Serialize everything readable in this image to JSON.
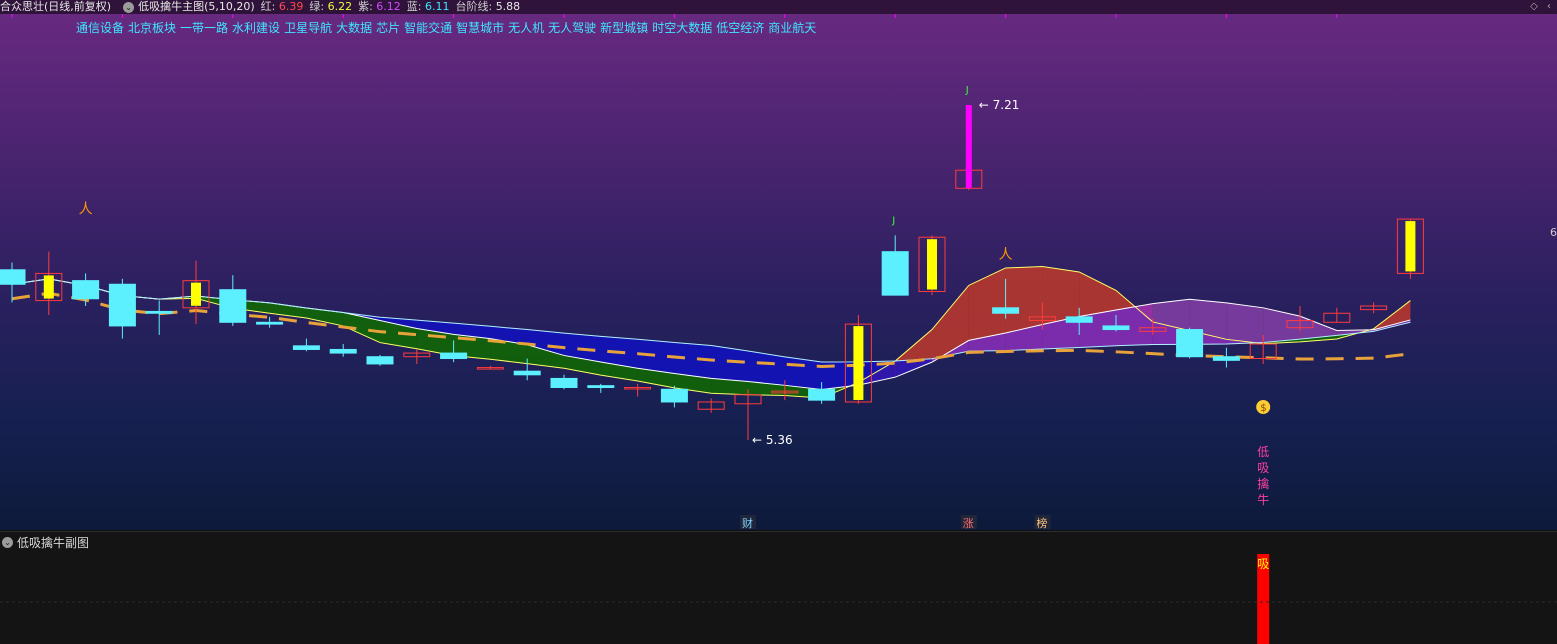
{
  "title_bar": {
    "stock_name": "合众思壮(日线,前复权)",
    "indicator_name": "低吸擒牛主图(5,10,20)",
    "values": [
      {
        "label": "红:",
        "value": "6.39",
        "color": "#ff4b4b"
      },
      {
        "label": "绿:",
        "value": "6.22",
        "color": "#e8ff3a"
      },
      {
        "label": "紫:",
        "value": "6.12",
        "color": "#d24bff"
      },
      {
        "label": "蓝:",
        "value": "6.11",
        "color": "#3ee6ff"
      },
      {
        "label": "台阶线:",
        "value": "5.88",
        "color": "#e8e8e8"
      }
    ]
  },
  "concept_tags": [
    "通信设备",
    "北京板块",
    "一带一路",
    "水利建设",
    "卫星导航",
    "大数据",
    "芯片",
    "智能交通",
    "智慧城市",
    "无人机",
    "无人驾驶",
    "新型城镇",
    "时空大数据",
    "低空经济",
    "商业航天"
  ],
  "annotations": {
    "high_price": "7.21",
    "low_price": "5.36",
    "j_marker": "J",
    "signal_vertical": [
      "低",
      "吸",
      "擒",
      "牛"
    ],
    "money_icon": "$",
    "walker_icon": "人",
    "bottom_markers": [
      "财",
      "涨",
      "榜"
    ]
  },
  "right_axis_label": "6",
  "sub_panel": {
    "title": "低吸擒牛副图",
    "bar_label": "吸"
  },
  "colors": {
    "up_candle": "#ff3b3b",
    "down_candle": "#5cf0ff",
    "upper_yellow": "#ffff00",
    "ribbon_red": "#c0392b",
    "ribbon_green": "#0f6b00",
    "ribbon_blue": "#1010c8",
    "ribbon_purple": "#9030c0",
    "step_line": "#e8a23a",
    "magenta": "#ff00ff"
  },
  "chart_data": {
    "type": "candlestick",
    "series_order": "oldest to newest, 39 daily bars",
    "ohlc": [
      [
        6.3,
        6.34,
        6.12,
        6.22
      ],
      [
        6.13,
        6.4,
        6.05,
        6.28
      ],
      [
        6.24,
        6.28,
        6.1,
        6.14
      ],
      [
        6.22,
        6.25,
        5.92,
        5.99
      ],
      [
        6.07,
        6.13,
        5.94,
        6.06
      ],
      [
        6.09,
        6.35,
        6.0,
        6.24
      ],
      [
        6.19,
        6.27,
        5.99,
        6.01
      ],
      [
        6.01,
        6.04,
        5.98,
        6.0
      ],
      [
        5.88,
        5.92,
        5.85,
        5.86
      ],
      [
        5.86,
        5.89,
        5.82,
        5.84
      ],
      [
        5.82,
        5.83,
        5.77,
        5.78
      ],
      [
        5.82,
        5.86,
        5.78,
        5.84
      ],
      [
        5.84,
        5.91,
        5.79,
        5.81
      ],
      [
        5.76,
        5.77,
        5.75,
        5.76
      ],
      [
        5.74,
        5.81,
        5.69,
        5.72
      ],
      [
        5.7,
        5.72,
        5.64,
        5.65
      ],
      [
        5.66,
        5.67,
        5.62,
        5.65
      ],
      [
        5.65,
        5.67,
        5.6,
        5.65
      ],
      [
        5.64,
        5.66,
        5.54,
        5.57
      ],
      [
        5.53,
        5.59,
        5.51,
        5.57
      ],
      [
        5.56,
        5.64,
        5.36,
        5.61
      ],
      [
        5.62,
        5.69,
        5.58,
        5.63
      ],
      [
        5.64,
        5.68,
        5.56,
        5.58
      ],
      [
        5.57,
        6.05,
        5.56,
        6.0
      ],
      [
        6.4,
        6.49,
        6.16,
        6.16
      ],
      [
        6.18,
        6.49,
        6.16,
        6.48
      ],
      [
        6.75,
        7.21,
        6.74,
        6.85
      ],
      [
        6.09,
        6.25,
        6.03,
        6.06
      ],
      [
        6.02,
        6.12,
        5.97,
        6.04
      ],
      [
        6.04,
        6.09,
        5.94,
        6.01
      ],
      [
        5.99,
        6.05,
        5.96,
        5.97
      ],
      [
        5.96,
        6.03,
        5.94,
        5.98
      ],
      [
        5.97,
        5.98,
        5.81,
        5.82
      ],
      [
        5.82,
        5.87,
        5.76,
        5.8
      ],
      [
        5.81,
        5.94,
        5.78,
        5.89
      ],
      [
        5.98,
        6.1,
        5.96,
        6.02
      ],
      [
        6.01,
        6.09,
        6.01,
        6.06
      ],
      [
        6.08,
        6.12,
        6.06,
        6.1
      ],
      [
        6.28,
        6.58,
        6.25,
        6.58
      ]
    ]
  }
}
